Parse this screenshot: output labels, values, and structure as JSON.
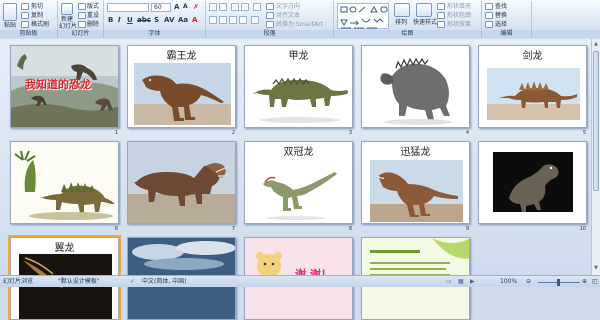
{
  "ribbon": {
    "clipboard": {
      "paste_label": "粘贴",
      "cut_label": "剪切",
      "copy_label": "复制",
      "format_painter_label": "格式刷",
      "group_label": "剪贴板"
    },
    "slides": {
      "new_slide_label": "新建",
      "new_slide_label2": "幻灯片",
      "layout_label": "版式",
      "reset_label": "重设",
      "delete_label": "删除",
      "group_label": "幻灯片"
    },
    "font": {
      "font_name": "",
      "font_size": "60",
      "group_label": "字体"
    },
    "paragraph": {
      "text_direction_label": "文字方向",
      "align_text_label": "对齐文本",
      "smartart_label": "转换为 SmartArt",
      "group_label": "段落"
    },
    "drawing": {
      "arrange_label": "排列",
      "quick_styles_label": "快速样式",
      "shape_fill_label": "形状填充",
      "shape_outline_label": "形状轮廓",
      "shape_effects_label": "形状效果",
      "group_label": "绘图"
    },
    "editing": {
      "find_label": "查找",
      "replace_label": "替换",
      "select_label": "选择",
      "group_label": "编辑"
    }
  },
  "slides": [
    {
      "number": "1",
      "title": "我知道的恐龙",
      "image": "dinosaur-scene"
    },
    {
      "number": "2",
      "title": "霸王龙",
      "image": "tyrannosaurus"
    },
    {
      "number": "3",
      "title": "甲龙",
      "image": "ankylosaurus"
    },
    {
      "number": "4",
      "title": "",
      "image": "armored-dinosaur"
    },
    {
      "number": "5",
      "title": "剑龙",
      "image": "stegosaurus-small"
    },
    {
      "number": "6",
      "title": "",
      "image": "stegosaurus"
    },
    {
      "number": "7",
      "title": "",
      "image": "triceratops"
    },
    {
      "number": "8",
      "title": "双冠龙",
      "image": "dilophosaurus"
    },
    {
      "number": "9",
      "title": "迅猛龙",
      "image": "velociraptor"
    },
    {
      "number": "10",
      "title": "",
      "image": "dark-dinosaur"
    },
    {
      "number": "",
      "title": "翼龙",
      "image": "pterosaur"
    },
    {
      "number": "",
      "title": "",
      "image": "sky"
    },
    {
      "number": "",
      "title": "谢 谢！",
      "image": "bear-thanks"
    },
    {
      "number": "",
      "title": "",
      "image": "green-text-slide"
    }
  ],
  "status": {
    "view_label": "幻灯片浏览",
    "theme_label": "\"默认设计模板\"",
    "language_label": "中文(简体, 中国)",
    "zoom": "100%"
  },
  "colors": {
    "accent": "#f0a93b",
    "ribbon": "#dce8f6",
    "title_red": "#e0282f"
  }
}
